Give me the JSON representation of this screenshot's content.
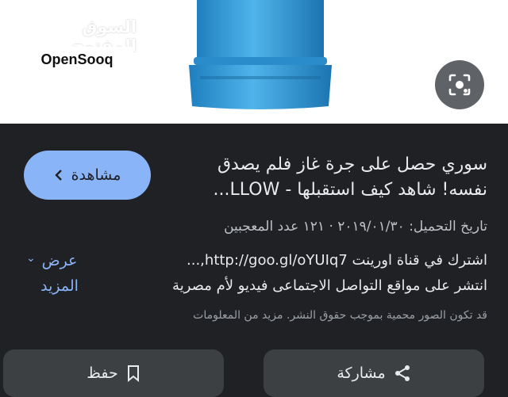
{
  "image_area": {
    "watermark_arabic": "السوق المفتوح",
    "watermark_latin": "OpenSooq",
    "lens_icon": "camera-lens-icon"
  },
  "video": {
    "watch_label": "مشاهدة",
    "title_line1": "سوري حصل على جرة غاز فلم يصدق",
    "title_line2": "نفسه! شاهد كيف استقبلها - LLOW...",
    "meta": "تاريخ التحميل: ٢٠١٩/٠١/٣٠ · ١٢١ عدد المعجبين",
    "desc_line1": "اشترك في قناة اورينت http://goo.gl/oYUIq7,...",
    "desc_line2": "انتشر على مواقع التواصل الاجتماعى فيديو لأم مصرية",
    "more_label": "عرض المزيد",
    "notice": "قد تكون الصور محمية بموجب حقوق النشر. مزيد من المعلومات"
  },
  "actions": {
    "save_label": "حفظ",
    "share_label": "مشاركة"
  },
  "colors": {
    "accent": "#8ab4f8",
    "cylinder": "#3aa0d8",
    "background": "#202124"
  }
}
